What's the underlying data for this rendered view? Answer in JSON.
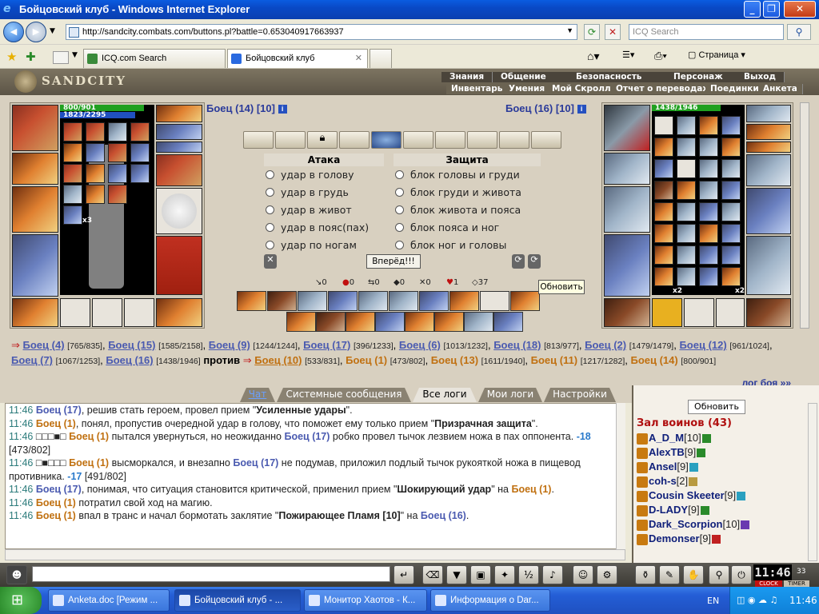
{
  "window": {
    "title": "Бойцовский клуб - Windows Internet Explorer"
  },
  "nav": {
    "url": "http://sandcity.combats.com/buttons.pl?battle=0.653040917663937",
    "search_placeholder": "ICQ Search"
  },
  "tabs": [
    {
      "label": "ICQ.com Search"
    },
    {
      "label": "Бойцовский клуб"
    }
  ],
  "toolbar": {
    "page_label": "Страница"
  },
  "game": {
    "logo": "SANDCITY",
    "menu_top": [
      "Знания",
      "Общение",
      "Безопасность",
      "Персонаж",
      "Выход"
    ],
    "menu_bottom": [
      "Инвентарь",
      "Умения",
      "Мой Скролл",
      "Отчет о переводах",
      "Поединки",
      "Анкета"
    ],
    "left_fighter": {
      "name": "Боец (14) [10]",
      "hp": "800/901",
      "mana": "1823/2295",
      "hp_fraction": 0.888,
      "mana_fraction": 0.794,
      "stack": "x3"
    },
    "right_fighter": {
      "name": "Боец (16) [10]",
      "hp": "1438/1946",
      "hp_fraction": 0.739,
      "stack1": "x2",
      "stack2": "x2"
    },
    "attack_title": "Атака",
    "defense_title": "Защита",
    "attacks": [
      "удар в голову",
      "удар в грудь",
      "удар в живот",
      "удар в пояс(пах)",
      "удар по ногам"
    ],
    "defenses": [
      "блок головы и груди",
      "блок груди и живота",
      "блок живота и пояса",
      "блок пояса и ног",
      "блок ног и головы"
    ],
    "go_button": "Вперёд!!!",
    "refresh_tip": "Обновить",
    "stats": [
      "0",
      "0",
      "0",
      "0",
      "0",
      "1",
      "37"
    ],
    "teams": {
      "team1": [
        {
          "name": "Боец (4)",
          "hp": "[765/835]"
        },
        {
          "name": "Боец (15)",
          "hp": "[1585/2158]"
        },
        {
          "name": "Боец (9)",
          "hp": "[1244/1244]"
        },
        {
          "name": "Боец (17)",
          "hp": "[396/1233]"
        },
        {
          "name": "Боец (6)",
          "hp": "[1013/1232]"
        },
        {
          "name": "Боец (18)",
          "hp": "[813/977]"
        },
        {
          "name": "Боец (2)",
          "hp": "[1479/1479]"
        },
        {
          "name": "Боец (12)",
          "hp": "[961/1024]"
        },
        {
          "name": "Боец (7)",
          "hp": "[1067/1253]"
        },
        {
          "name": "Боец (16)",
          "hp": "[1438/1946]"
        }
      ],
      "vs": "против",
      "team2": [
        {
          "name": "Боец (10)",
          "hp": "[533/831]"
        },
        {
          "name": "Боец (1)",
          "hp": "[473/802]"
        },
        {
          "name": "Боец (13)",
          "hp": "[1611/1940]"
        },
        {
          "name": "Боец (11)",
          "hp": "[1217/1282]"
        },
        {
          "name": "Боец (14)",
          "hp": "[800/901]"
        }
      ],
      "log_link": "лог боя »»"
    }
  },
  "log_tabs": [
    "Чат",
    "Системные сообщения",
    "Все логи",
    "Мои логи",
    "Настройки"
  ],
  "log_lines": [
    {
      "time": "11:46",
      "parts": [
        {
          "t": "Боец (17)",
          "c": "blue"
        },
        {
          "t": ", решив стать героем, провел прием \"",
          "c": ""
        },
        {
          "t": "Усиленные удары",
          "c": "bold"
        },
        {
          "t": "\".",
          "c": ""
        }
      ]
    },
    {
      "time": "11:46",
      "parts": [
        {
          "t": "Боец (1)",
          "c": "org"
        },
        {
          "t": ", понял, пропустив очередной удар в голову, что поможет ему только прием \"",
          "c": ""
        },
        {
          "t": "Призрачная защита",
          "c": "bold"
        },
        {
          "t": "\".",
          "c": ""
        }
      ]
    },
    {
      "time": "11:46",
      "parts": [
        {
          "t": "□□□■□ ",
          "c": ""
        },
        {
          "t": "Боец (1)",
          "c": "org"
        },
        {
          "t": " пытался увернуться, но неожиданно ",
          "c": ""
        },
        {
          "t": "Боец (17)",
          "c": "blue"
        },
        {
          "t": " робко провел тычок лезвием ножа в пах оппонента. ",
          "c": ""
        },
        {
          "t": "-18",
          "c": "dmg"
        },
        {
          "t": " [473/802]",
          "c": ""
        }
      ]
    },
    {
      "time": "11:46",
      "parts": [
        {
          "t": "□■□□□ ",
          "c": ""
        },
        {
          "t": "Боец (1)",
          "c": "org"
        },
        {
          "t": " высморкался, и внезапно ",
          "c": ""
        },
        {
          "t": "Боец (17)",
          "c": "blue"
        },
        {
          "t": " не подумав, приложил подлый тычок рукояткой ножа в пищевод противника. ",
          "c": ""
        },
        {
          "t": "-17",
          "c": "dmg"
        },
        {
          "t": " [491/802]",
          "c": ""
        }
      ]
    },
    {
      "time": "11:46",
      "parts": [
        {
          "t": "Боец (17)",
          "c": "blue"
        },
        {
          "t": ", понимая, что ситуация становится критической, применил прием \"",
          "c": ""
        },
        {
          "t": "Шокирующий удар",
          "c": "bold"
        },
        {
          "t": "\" на ",
          "c": ""
        },
        {
          "t": "Боец (1)",
          "c": "org"
        },
        {
          "t": ".",
          "c": ""
        }
      ]
    },
    {
      "time": "11:46",
      "parts": [
        {
          "t": "Боец (1)",
          "c": "org"
        },
        {
          "t": " потратил свой ход на магию.",
          "c": ""
        }
      ]
    },
    {
      "time": "11:46",
      "parts": [
        {
          "t": "Боец (1)",
          "c": "org"
        },
        {
          "t": " впал в транс и начал бормотать заклятие \"",
          "c": ""
        },
        {
          "t": "Пожирающее Пламя [10]",
          "c": "bold"
        },
        {
          "t": "\" на ",
          "c": ""
        },
        {
          "t": "Боец (16)",
          "c": "blue"
        },
        {
          "t": ".",
          "c": ""
        }
      ]
    }
  ],
  "war_room": {
    "refresh": "Обновить",
    "title": "Зал воинов (43)",
    "players": [
      {
        "name": "A_D_M",
        "level": "[10]",
        "badge": "#2a8a2a"
      },
      {
        "name": "AlexTB",
        "level": "[9]",
        "badge": "#2a8a2a"
      },
      {
        "name": "Ansel",
        "level": "[9]",
        "badge": "#2aa0c0"
      },
      {
        "name": "coh-s",
        "level": "[2]",
        "badge": "#b89a40"
      },
      {
        "name": "Cousin Skeeter",
        "level": "[9]",
        "badge": "#2aa0c0"
      },
      {
        "name": "D-LADY",
        "level": "[9]",
        "badge": "#2a8a2a"
      },
      {
        "name": "Dark_Scorpion",
        "level": "[10]",
        "badge": "#6a3ab0"
      },
      {
        "name": "Demonser",
        "level": "[9]",
        "badge": "#c02020"
      }
    ]
  },
  "clock": {
    "time": "11:46",
    "seconds": "33",
    "label_clock": "CLOCK",
    "label_timer": "TIMER"
  },
  "taskbar": {
    "tasks": [
      "Anketa.doc [Режим ...",
      "Бойцовский клуб - ...",
      "Монитор Хаотов - К...",
      "Информация о Dar..."
    ],
    "lang": "EN",
    "time": "11:46"
  }
}
